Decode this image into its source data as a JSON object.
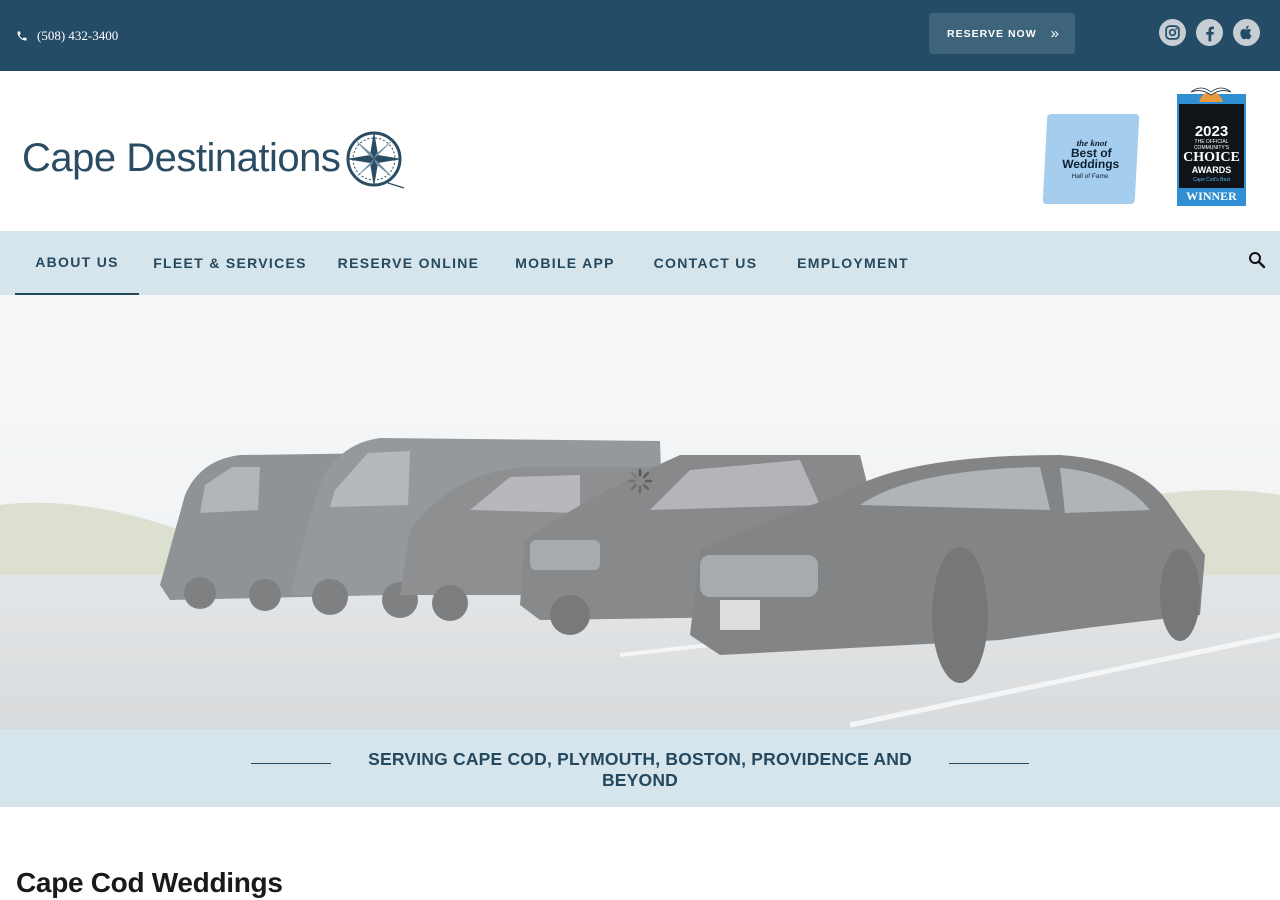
{
  "topbar": {
    "phone": "(508) 432-3400",
    "reserve_label": "RESERVE NOW",
    "reserve_chevron": "»",
    "social": [
      "instagram-icon",
      "facebook-icon",
      "apple-icon"
    ]
  },
  "header": {
    "logo_text": "Cape Destinations",
    "badge_knot": {
      "brand": "the knot",
      "title_line1": "Best of",
      "title_line2": "Weddings",
      "subtitle": "Hall of Fame"
    },
    "badge_choice": {
      "year": "2023",
      "line1": "THE OFFICIAL",
      "line2": "COMMUNITY'S",
      "choice": "CHOICE",
      "awards": "AWARDS",
      "region": "Cape Cod's Best",
      "winner": "WINNER"
    }
  },
  "nav": {
    "items": [
      {
        "label": "ABOUT US"
      },
      {
        "label": "FLEET & SERVICES"
      },
      {
        "label": "RESERVE ONLINE"
      },
      {
        "label": "MOBILE APP"
      },
      {
        "label": "CONTACT US"
      },
      {
        "label": "EMPLOYMENT"
      }
    ],
    "active_index": 0,
    "search_icon": "search-icon"
  },
  "band": {
    "tagline": "SERVING CAPE COD, PLYMOUTH, BOSTON, PROVIDENCE AND BEYOND"
  },
  "content": {
    "title": "Cape Cod Weddings"
  },
  "colors": {
    "topbar": "#244c67",
    "button": "#3e647c",
    "nav_bg": "#d6e4ec",
    "text_dark": "#24495f"
  }
}
